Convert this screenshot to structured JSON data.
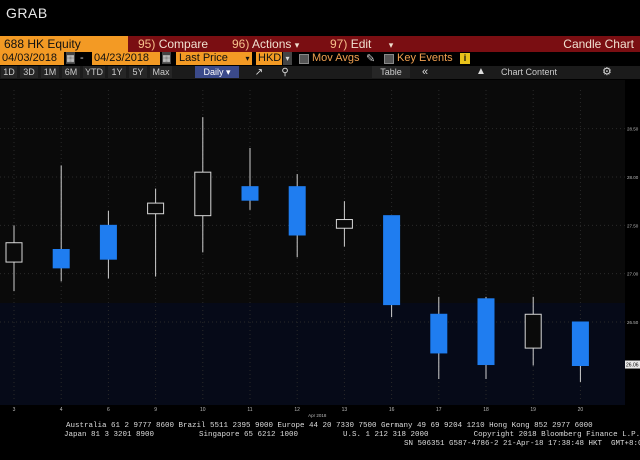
{
  "app": {
    "brand": "GRAB"
  },
  "toolbar": {
    "ticker": "688 HK Equity",
    "compare_num": "95)",
    "compare_label": "Compare",
    "actions_num": "96)",
    "actions_label": "Actions",
    "edit_num": "97)",
    "edit_label": "Edit",
    "chart_type": "Candle Chart"
  },
  "controls": {
    "start_date": "04/03/2018",
    "end_date": "04/23/2018",
    "dash": "-",
    "price_field": "Last Price",
    "currency": "HKD",
    "mov_avgs": "Mov Avgs",
    "key_events": "Key Events",
    "info_glyph": "i"
  },
  "ranges": {
    "items": [
      "1D",
      "3D",
      "1M",
      "6M",
      "YTD",
      "1Y",
      "5Y",
      "Max"
    ],
    "frequency": "Daily",
    "table_label": "Table",
    "chart_content_label": "Chart Content"
  },
  "icons": {
    "calendar": "calendar-icon",
    "pencil": "pencil-icon",
    "line_chart": "line-chart-icon",
    "zoom": "zoom-icon",
    "collapse": "double-chevron-left-icon",
    "settings": "gear-icon"
  },
  "colors": {
    "up": "#1f7df0",
    "down_fill": "#0a0a0a",
    "down_stroke": "#d8d8d8",
    "wick": "#cfcfcf",
    "orange": "#f39a24",
    "red": "#7a0e12"
  },
  "chart_data": {
    "type": "candlestick",
    "x": [
      "3",
      "4",
      "6",
      "9",
      "10",
      "11",
      "12",
      "13",
      "16",
      "17",
      "18",
      "19",
      "20"
    ],
    "month_label": "Apr 2018",
    "ylim": [
      25.9,
      28.9
    ],
    "y_ticks": [
      "26.50",
      "27.00",
      "27.50",
      "28.00",
      "28.50"
    ],
    "last_price_label": "26.06",
    "candles": [
      {
        "x": "3",
        "open": 27.32,
        "close": 27.12,
        "high": 27.5,
        "low": 26.82,
        "dir": "down"
      },
      {
        "x": "4",
        "open": 27.06,
        "close": 27.25,
        "high": 28.12,
        "low": 26.92,
        "dir": "up"
      },
      {
        "x": "6",
        "open": 27.15,
        "close": 27.5,
        "high": 27.65,
        "low": 26.95,
        "dir": "up"
      },
      {
        "x": "9",
        "open": 27.73,
        "close": 27.62,
        "high": 27.88,
        "low": 26.97,
        "dir": "down"
      },
      {
        "x": "10",
        "open": 28.05,
        "close": 27.6,
        "high": 28.62,
        "low": 27.22,
        "dir": "down"
      },
      {
        "x": "11",
        "open": 27.76,
        "close": 27.9,
        "high": 28.3,
        "low": 27.66,
        "dir": "up"
      },
      {
        "x": "12",
        "open": 27.4,
        "close": 27.9,
        "high": 28.03,
        "low": 27.17,
        "dir": "up"
      },
      {
        "x": "13",
        "open": 27.56,
        "close": 27.47,
        "high": 27.75,
        "low": 27.28,
        "dir": "down"
      },
      {
        "x": "16",
        "open": 26.68,
        "close": 27.6,
        "high": 27.6,
        "low": 26.55,
        "dir": "up"
      },
      {
        "x": "17",
        "open": 26.18,
        "close": 26.58,
        "high": 26.76,
        "low": 25.91,
        "dir": "up"
      },
      {
        "x": "18",
        "open": 26.06,
        "close": 26.74,
        "high": 26.76,
        "low": 25.91,
        "dir": "up"
      },
      {
        "x": "19",
        "open": 26.58,
        "close": 26.23,
        "high": 26.76,
        "low": 26.05,
        "dir": "down"
      },
      {
        "x": "20",
        "open": 26.05,
        "close": 26.5,
        "high": 26.5,
        "low": 25.88,
        "dir": "up"
      }
    ]
  },
  "footer": {
    "line1": "Australia 61 2 9777 8600 Brazil 5511 2395 9000 Europe 44 20 7330 7500 Germany 49 69 9204 1210 Hong Kong 852 2977 6000",
    "line2": "Japan 81 3 3201 8900          Singapore 65 6212 1000          U.S. 1 212 318 2000          Copyright 2018 Bloomberg Finance L.P.",
    "line3": "SN 506351 G587-4786-2 21-Apr-18 17:38:48 HKT  GMT+8:00"
  }
}
